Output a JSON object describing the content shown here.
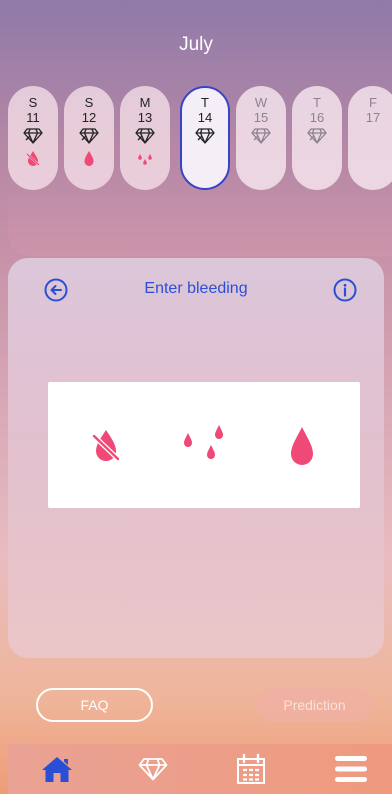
{
  "header": {
    "month": "July"
  },
  "days": [
    {
      "weekday": "S",
      "date": "11",
      "state": "past",
      "bleeding": "no-bleeding"
    },
    {
      "weekday": "S",
      "date": "12",
      "state": "past",
      "bleeding": "heavy"
    },
    {
      "weekday": "M",
      "date": "13",
      "state": "past",
      "bleeding": "spotting"
    },
    {
      "weekday": "T",
      "date": "14",
      "state": "selected",
      "bleeding": "none"
    },
    {
      "weekday": "W",
      "date": "15",
      "state": "future",
      "bleeding": "none"
    },
    {
      "weekday": "T",
      "date": "16",
      "state": "future",
      "bleeding": "none"
    },
    {
      "weekday": "F",
      "date": "17",
      "state": "future",
      "bleeding": "none"
    }
  ],
  "card": {
    "title": "Enter bleeding",
    "back_icon": "arrow-left-circle-icon",
    "info_icon": "info-circle-icon",
    "options": [
      {
        "icon": "no-bleeding-icon"
      },
      {
        "icon": "spotting-icon"
      },
      {
        "icon": "bleeding-drop-icon"
      }
    ]
  },
  "buttons": {
    "faq": "FAQ",
    "prediction": "Prediction"
  },
  "nav": [
    {
      "icon": "home-icon",
      "active": true
    },
    {
      "icon": "diamond-icon",
      "active": false
    },
    {
      "icon": "calendar-icon",
      "active": false
    },
    {
      "icon": "menu-icon",
      "active": false
    }
  ],
  "colors": {
    "accent_blue": "#2a4fd6",
    "bleeding_pink": "#ef4a77",
    "white": "#ffffff"
  }
}
